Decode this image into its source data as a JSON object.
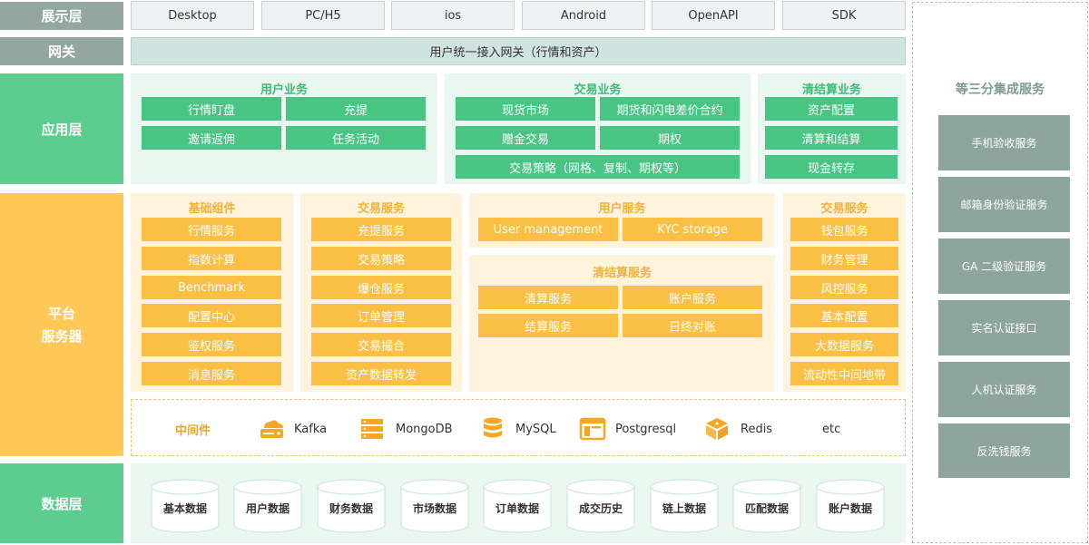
{
  "layers": {
    "presentation": "展示层",
    "gateway": "网关",
    "application": "应用层",
    "platform_line1": "平台",
    "platform_line2": "服务器",
    "data": "数据层"
  },
  "presentation_items": [
    "Desktop",
    "PC/H5",
    "ios",
    "Android",
    "OpenAPI",
    "SDK"
  ],
  "gateway_text": "用户统一接入网关（行情和资产）",
  "application": {
    "user_business": {
      "title": "用户业务",
      "items": [
        "行情盯盘",
        "充提",
        "邀请返佣",
        "任务活动"
      ]
    },
    "trade_business": {
      "title": "交易业务",
      "items": [
        "现货市场",
        "期货和闪电差价合约",
        "赠金交易",
        "期权",
        "交易策略（网格、复制、期权等）"
      ]
    },
    "settlement_business": {
      "title": "清结算业务",
      "items": [
        "资产配置",
        "清算和结算",
        "现金转存"
      ]
    }
  },
  "platform": {
    "base_components": {
      "title": "基础组件",
      "items": [
        "行情服务",
        "指数计算",
        "Benchmark",
        "配置中心",
        "鉴权服务",
        "消息服务"
      ]
    },
    "trade_services": {
      "title": "交易服务",
      "items": [
        "充提服务",
        "交易策略",
        "爆仓服务",
        "订单管理",
        "交易撮合",
        "资产数据转发"
      ]
    },
    "user_services": {
      "title": "用户服务",
      "items": [
        "User management",
        "KYC storage"
      ]
    },
    "settlement_services": {
      "title": "清结算服务",
      "items": [
        "清算服务",
        "账户服务",
        "结算服务",
        "日终对账"
      ]
    },
    "trade_services_2": {
      "title": "交易服务",
      "items": [
        "钱包服务",
        "财务管理",
        "风控服务",
        "基本配置",
        "大数据服务",
        "流动性中间地带"
      ]
    }
  },
  "middleware": {
    "label": "中间件",
    "items": [
      {
        "name": "Kafka",
        "icon": "cloud-server-icon"
      },
      {
        "name": "MongoDB",
        "icon": "server-rack-icon"
      },
      {
        "name": "MySQL",
        "icon": "database-icon"
      },
      {
        "name": "Postgresql",
        "icon": "window-layout-icon"
      },
      {
        "name": "Redis",
        "icon": "cube-stack-icon"
      },
      {
        "name": "etc",
        "icon": ""
      }
    ]
  },
  "data_stores": [
    "基本数据",
    "用户数据",
    "财务数据",
    "市场数据",
    "订单数据",
    "成交历史",
    "链上数据",
    "匹配数据",
    "账户数据"
  ],
  "third_party": {
    "title": "等三分集成服务",
    "items": [
      "手机验收服务",
      "邮箱身份验证服务",
      "GA 二级验证服务",
      "实名认证接口",
      "人机认证服务",
      "反洗钱服务"
    ]
  },
  "colors": {
    "gray": "#93a7a0",
    "green": "#5ccc8f",
    "yellow": "#ffc857",
    "orange_icon": "#f5a623"
  }
}
